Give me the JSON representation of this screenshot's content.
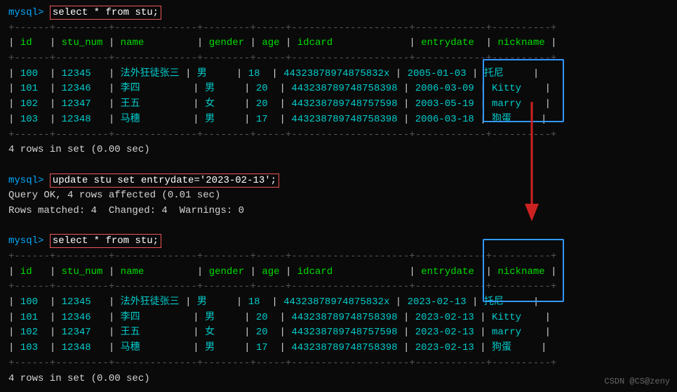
{
  "terminal": {
    "prompt": "mysql>",
    "commands": [
      "select * from stu;",
      "update stu set entrydate='2023-02-13';",
      "select * from stu;"
    ],
    "table_headers": [
      "id",
      "stu_num",
      "name",
      "gender",
      "age",
      "idcard",
      "entrydate",
      "nickname"
    ],
    "rows_before": [
      [
        "100",
        "12345",
        "法外狂徒张三",
        "男",
        "18",
        "44323878974875832x",
        "2005-01-03",
        "托尼"
      ],
      [
        "101",
        "12346",
        "李四",
        "男",
        "20",
        "443238789748758398",
        "2006-03-09",
        "Kitty"
      ],
      [
        "102",
        "12347",
        "王五",
        "女",
        "20",
        "443238789748757598",
        "2003-05-19",
        "marry"
      ],
      [
        "103",
        "12348",
        "马穗",
        "男",
        "17",
        "443238789748758398",
        "2006-03-18",
        "狗蛋"
      ]
    ],
    "rows_after": [
      [
        "100",
        "12345",
        "法外狂徒张三",
        "男",
        "18",
        "44323878974875832x",
        "2023-02-13",
        "托尼"
      ],
      [
        "101",
        "12346",
        "李四",
        "男",
        "20",
        "443238789748758398",
        "2023-02-13",
        "Kitty"
      ],
      [
        "102",
        "12347",
        "王五",
        "女",
        "20",
        "443238789748757598",
        "2023-02-13",
        "marry"
      ],
      [
        "103",
        "12348",
        "马穗",
        "男",
        "17",
        "443238789748758398",
        "2023-02-13",
        "狗蛋"
      ]
    ],
    "result_line": "4 rows in set (0.00 sec)",
    "query_ok": "Query OK, 4 rows affected (0.01 sec)",
    "rows_matched": "Rows matched: 4  Changed: 4  Warnings: 0",
    "watermark": "CSDN @CS@zeny"
  }
}
